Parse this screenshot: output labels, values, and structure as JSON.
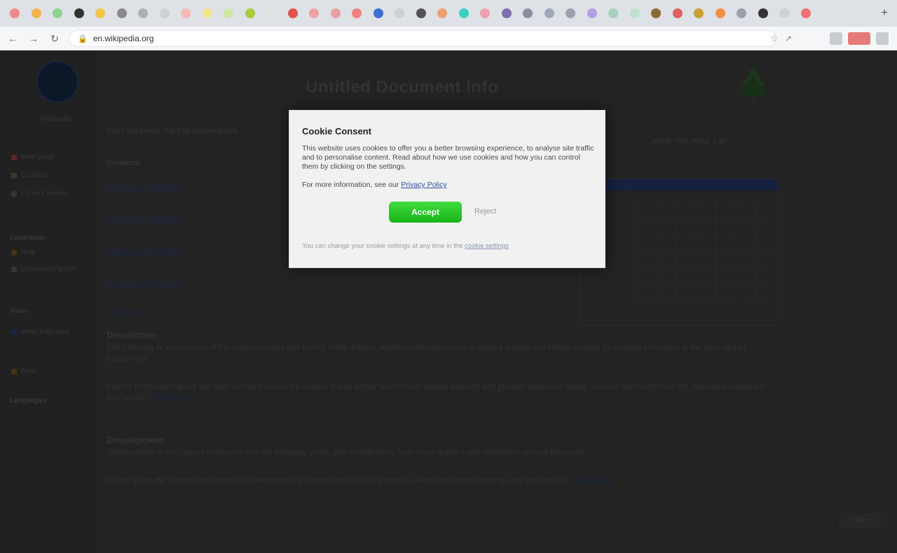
{
  "browser": {
    "url": "en.wikipedia.org",
    "tab_colors": [
      "#f08a8a",
      "#f5b24a",
      "#8ed08e",
      "#333333",
      "#f3c64b",
      "#8a8a8a",
      "#b0b0b0",
      "#d0d0d0",
      "#f7b8b8",
      "#f7e48a",
      "#cfe6a2",
      "#a8cc3a",
      "#e0e0e0",
      "#e0534f",
      "#f0a0a0",
      "#e8a0a0",
      "#f08080",
      "#3b6fd0",
      "#d0d0d0",
      "#555555",
      "#f0a070",
      "#3ccfc6",
      "#f0a0b0",
      "#7d6fb0",
      "#8890a0",
      "#a0a8b8",
      "#9aa2b0",
      "#b4a0e0",
      "#a8d0c0",
      "#c0e0d0",
      "#8b6a3a",
      "#e06060",
      "#c8a030",
      "#f09040",
      "#9aa0a8",
      "#333333",
      "#d0d0d0",
      "#f07070"
    ]
  },
  "page": {
    "site_title": "Untitled Document Info",
    "logo_caption": "Wikipedia",
    "crumb": "From Wikipedia, the free encyclopedia",
    "sub_links": [
      "Article",
      "Talk",
      "Read",
      "Edit"
    ],
    "heading": "Contents",
    "toc": [
      "Section 1 (header)",
      "Section 2 (header)",
      "Section 3 (header)",
      "Section 4 (header)"
    ],
    "see_also": "See also",
    "section_a": "Description",
    "para_a": "The following is an overview of the main concepts and history of the subject, together with references to related articles and further reading for readers interested in the topic and its background.",
    "para_b": "Further information about the topic can be found in the articles linked below, which cover related subjects and provide additional details, sources and context for the material presented in this section.",
    "para_b_link": "References",
    "section_b": "Development",
    "para_c": "Development of the subject continued over the following years, with contributions from many authors and institutions around the world.",
    "para_d": "In later years the subject was revised and expanded, and new material was added to reflect more recent findings and publications.",
    "para_d_link": "Main article"
  },
  "sidebar": {
    "items": [
      {
        "label": "Main page",
        "color": "#6b2a2a"
      },
      {
        "label": "Contents",
        "color": "#4a3b2a"
      },
      {
        "label": "Current events",
        "color": "#3a3a3a"
      }
    ],
    "heading_1": "Contribute",
    "items_2": [
      {
        "label": "Help",
        "color": "#4a3a1a"
      },
      {
        "label": "Community portal",
        "color": "#3a3a3a"
      }
    ],
    "heading_2": "Tools",
    "items_3": [
      {
        "label": "What links here",
        "color": "#1e2a4a"
      },
      {
        "label": "Print",
        "color": "#4a3a1a"
      }
    ],
    "heading_3": "Languages"
  },
  "modal": {
    "title": "Cookie Consent",
    "body": "This website uses cookies to offer you a better browsing experience, to analyse site traffic and to personalise content. Read about how we use cookies and how you can control them by clicking on the settings.",
    "link_prefix": "For more information, see our",
    "link_text": "Privacy Policy",
    "accept_label": "Accept",
    "reject_label": "Reject",
    "footer_text": "You can change your cookie settings at any time in the",
    "footer_link": "cookie settings"
  },
  "scroll_hint": "Top ↑"
}
